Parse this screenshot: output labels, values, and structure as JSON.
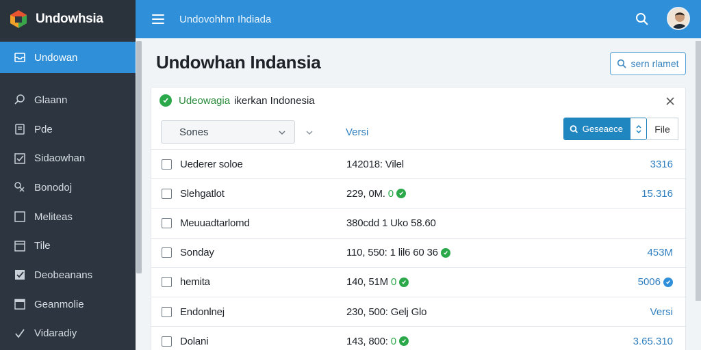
{
  "app": {
    "name": "Undowhsia",
    "top_title": "Undovohhm Ihdiada"
  },
  "colors": {
    "accent": "#2f8fd8",
    "success": "#2aa84a",
    "sidebar": "#2c3540",
    "link": "#2f7fc0"
  },
  "sidebar": {
    "active": {
      "label": "Undowan",
      "icon": "inbox-icon"
    },
    "items": [
      {
        "label": "Glaann",
        "icon": "search-icon"
      },
      {
        "label": "Pde",
        "icon": "document-icon"
      },
      {
        "label": "Sidaowhan",
        "icon": "check-box-icon"
      },
      {
        "label": "Bonodoj",
        "icon": "tools-icon"
      },
      {
        "label": "Meliteas",
        "icon": "square-icon"
      },
      {
        "label": "Tile",
        "icon": "folder-icon"
      },
      {
        "label": "Deobeanans",
        "icon": "check-box-icon"
      },
      {
        "label": "Geanmolie",
        "icon": "window-icon"
      },
      {
        "label": "Vidaradiy",
        "icon": "check-mark-icon"
      }
    ]
  },
  "main": {
    "title": "Undowhan Indansia",
    "search_button": "sern rlamet",
    "alert": {
      "brand": "Udeowagia",
      "text": "ikerkan Indonesia"
    },
    "select": {
      "value": "Sones"
    },
    "versi_link": "Versi",
    "primary_button": "Geseaece",
    "file_button": "File",
    "rows": [
      {
        "name": "Uederer soloe",
        "detail": "142018: Vilel",
        "detail_mark": "",
        "value": "3316",
        "value_mark": ""
      },
      {
        "name": "Slehgatlot",
        "detail": "229, 0M.",
        "detail_mark": "0",
        "value": "15.316",
        "value_mark": ""
      },
      {
        "name": "Meuuadtarlomd",
        "detail": "380cdd 1 Uko 58.60",
        "detail_mark": "",
        "value": "",
        "value_mark": ""
      },
      {
        "name": "Sonday",
        "detail": "110, 550: 1 lil6 60 36",
        "detail_mark": "",
        "value": "453M",
        "value_mark": ""
      },
      {
        "name": "hemita",
        "detail": "140, 51M",
        "detail_mark": "0",
        "value": "5006",
        "value_mark": "blue"
      },
      {
        "name": "Endonlnej",
        "detail": "230, 500: Gelj Glo",
        "detail_mark": "",
        "value": "Versi",
        "value_mark": ""
      },
      {
        "name": "Dolani",
        "detail": "143, 800:",
        "detail_mark": "0",
        "value": "3.65.310",
        "value_mark": ""
      }
    ]
  }
}
